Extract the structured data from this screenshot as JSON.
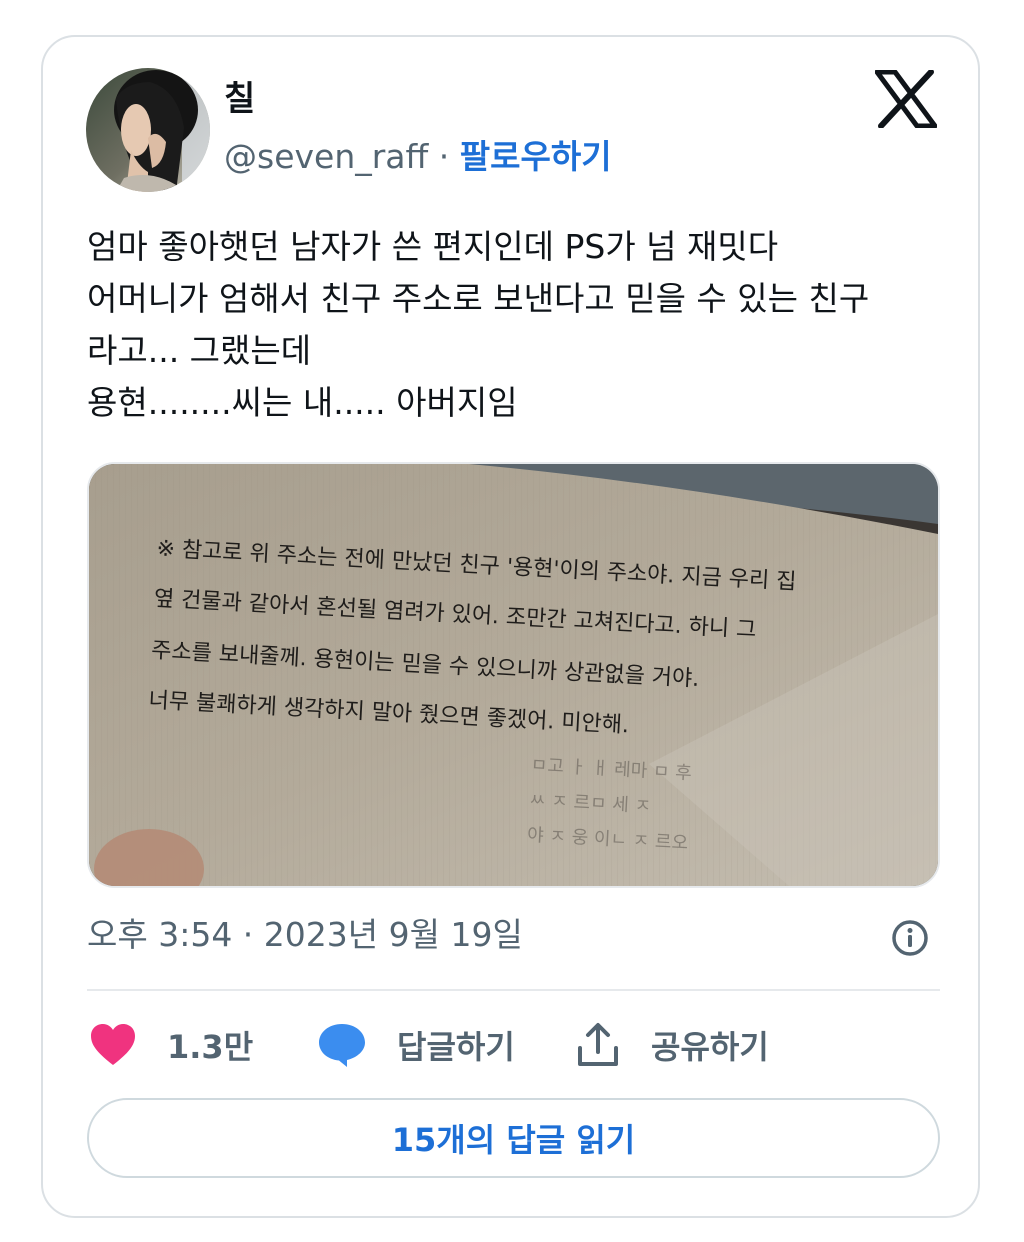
{
  "author": {
    "display_name": "칠",
    "handle": "@seven_raff",
    "separator": "·",
    "follow_label": "팔로우하기"
  },
  "platform_icon": "x-logo-icon",
  "tweet": {
    "lines": [
      "엄마 좋아햇던 남자가 쓴 편지인데 PS가 넘 재밋다",
      "어머니가 엄해서 친구 주소로 보낸다고 믿을 수 있는 친구",
      "라고... 그랬는데",
      "용현........씨는 내..... 아버지임"
    ]
  },
  "media": {
    "letter_lines": [
      "※ 참고로 위 주소는 전에 만났던 친구 '용현'이의 주소야. 지금 우리 집",
      "옆 건물과 같아서 혼선될 염려가 있어. 조만간 고쳐진다고. 하니 그",
      "주소를 보내줄께. 용현이는 믿을 수 있으니까 상관없을 거야.",
      "너무 불쾌하게 생각하지 말아 줬으면 좋겠어. 미안해."
    ],
    "back_lines": [
      "ㅁ고 ㅏ ㅐ 레마 ㅁ 후",
      "ㅆ ㅈ 르ㅁ 세 ㅈ",
      "야 ㅈ 웅 이ㄴ ㅈ 르오"
    ]
  },
  "meta": {
    "timestamp": "오후 3:54 · 2023년 9월 19일"
  },
  "actions": {
    "like_count": "1.3만",
    "reply_label": "답글하기",
    "share_label": "공유하기"
  },
  "read_replies_label": "15개의 답글 읽기",
  "colors": {
    "accent": "#1d6fd6",
    "like": "#f0337f",
    "reply": "#3b8def",
    "secondary_text": "#536471"
  }
}
